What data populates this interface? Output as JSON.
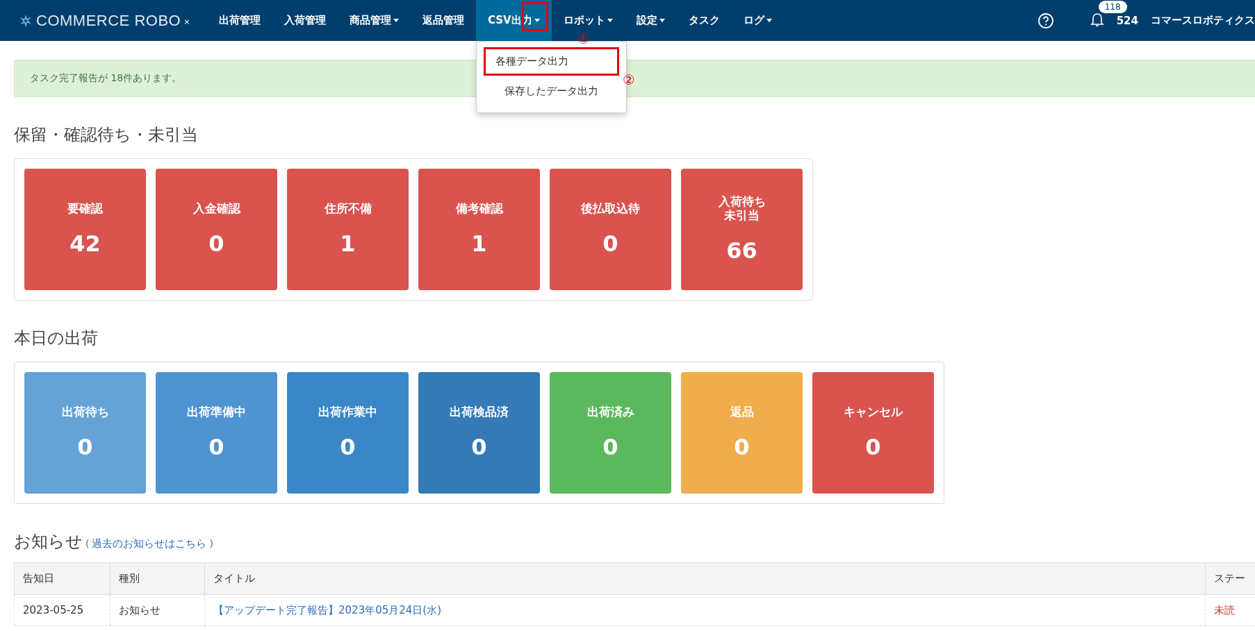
{
  "navbar": {
    "logo": {
      "text": "COMMERCE ROBO",
      "mark": "×"
    },
    "items": [
      {
        "label": "出荷管理",
        "dropdown": false,
        "selected": false
      },
      {
        "label": "入荷管理",
        "dropdown": false,
        "selected": false
      },
      {
        "label": "商品管理",
        "dropdown": true,
        "selected": false
      },
      {
        "label": "返品管理",
        "dropdown": false,
        "selected": false
      },
      {
        "label": "CSV出力",
        "dropdown": true,
        "selected": true
      },
      {
        "label": "ロボット",
        "dropdown": true,
        "selected": false
      },
      {
        "label": "設定",
        "dropdown": true,
        "selected": false
      },
      {
        "label": "タスク",
        "dropdown": false,
        "selected": false
      },
      {
        "label": "ログ",
        "dropdown": true,
        "selected": false
      }
    ],
    "notification_count": "118",
    "user_id": "524",
    "user_name": "コマースロボティクス"
  },
  "dropdown_menu": {
    "items": [
      {
        "label": "各種データ出力",
        "highlighted": true
      },
      {
        "label": "保存したデータ出力",
        "highlighted": false
      }
    ]
  },
  "annotations": [
    {
      "label": "①"
    },
    {
      "label": "②"
    }
  ],
  "alert": "タスク完了報告が 18件あります。",
  "sections": [
    {
      "title": "保留・確認待ち・未引当",
      "tiles": [
        {
          "label": [
            "要確認"
          ],
          "count": "42",
          "color": "#d9534f"
        },
        {
          "label": [
            "入金確認"
          ],
          "count": "0",
          "color": "#d9534f"
        },
        {
          "label": [
            "住所不備"
          ],
          "count": "1",
          "color": "#d9534f"
        },
        {
          "label": [
            "備考確認"
          ],
          "count": "1",
          "color": "#d9534f"
        },
        {
          "label": [
            "後払取込待"
          ],
          "count": "0",
          "color": "#d9534f"
        },
        {
          "label": [
            "入荷待ち",
            "未引当"
          ],
          "count": "66",
          "color": "#d9534f"
        }
      ]
    },
    {
      "title": "本日の出荷",
      "tiles": [
        {
          "label": [
            "出荷待ち"
          ],
          "count": "0",
          "color": "#65a2d6"
        },
        {
          "label": [
            "出荷準備中"
          ],
          "count": "0",
          "color": "#4f93d0"
        },
        {
          "label": [
            "出荷作業中"
          ],
          "count": "0",
          "color": "#3a87c8"
        },
        {
          "label": [
            "出荷検品済"
          ],
          "count": "0",
          "color": "#337ab7"
        },
        {
          "label": [
            "出荷済み"
          ],
          "count": "0",
          "color": "#5cb85c"
        },
        {
          "label": [
            "返品"
          ],
          "count": "0",
          "color": "#f0ad4e"
        },
        {
          "label": [
            "キャンセル"
          ],
          "count": "0",
          "color": "#d9534f"
        }
      ]
    }
  ],
  "news": {
    "title": "お知らせ",
    "link": "過去のお知らせはこちら",
    "paren_open": "(",
    "paren_close": ")",
    "table": {
      "columns": [
        "告知日",
        "種別",
        "タイトル",
        "ステー"
      ],
      "rows": [
        {
          "date": "2023-05-25",
          "type": "お知らせ",
          "title": "【アップデート完了報告】2023年05月24日(水)",
          "status": "未読",
          "unread": true
        }
      ]
    }
  }
}
